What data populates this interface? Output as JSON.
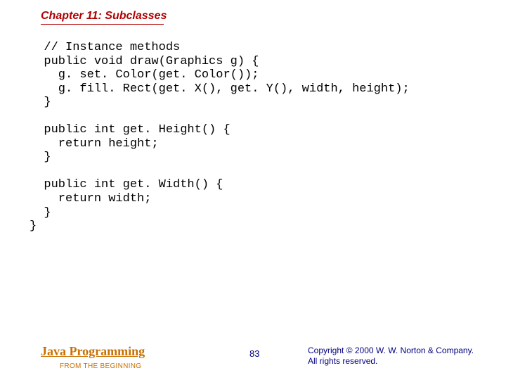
{
  "header": {
    "chapter_title": "Chapter 11: Subclasses"
  },
  "code": {
    "text": "  // Instance methods\n  public void draw(Graphics g) {\n    g. set. Color(get. Color());\n    g. fill. Rect(get. X(), get. Y(), width, height);\n  }\n\n  public int get. Height() {\n    return height;\n  }\n\n  public int get. Width() {\n    return width;\n  }\n}"
  },
  "footer": {
    "book_title": "Java Programming",
    "book_subtitle": "FROM THE BEGINNING",
    "page_number": "83",
    "copyright_line1": "Copyright © 2000 W. W. Norton & Company.",
    "copyright_line2": "All rights reserved."
  }
}
